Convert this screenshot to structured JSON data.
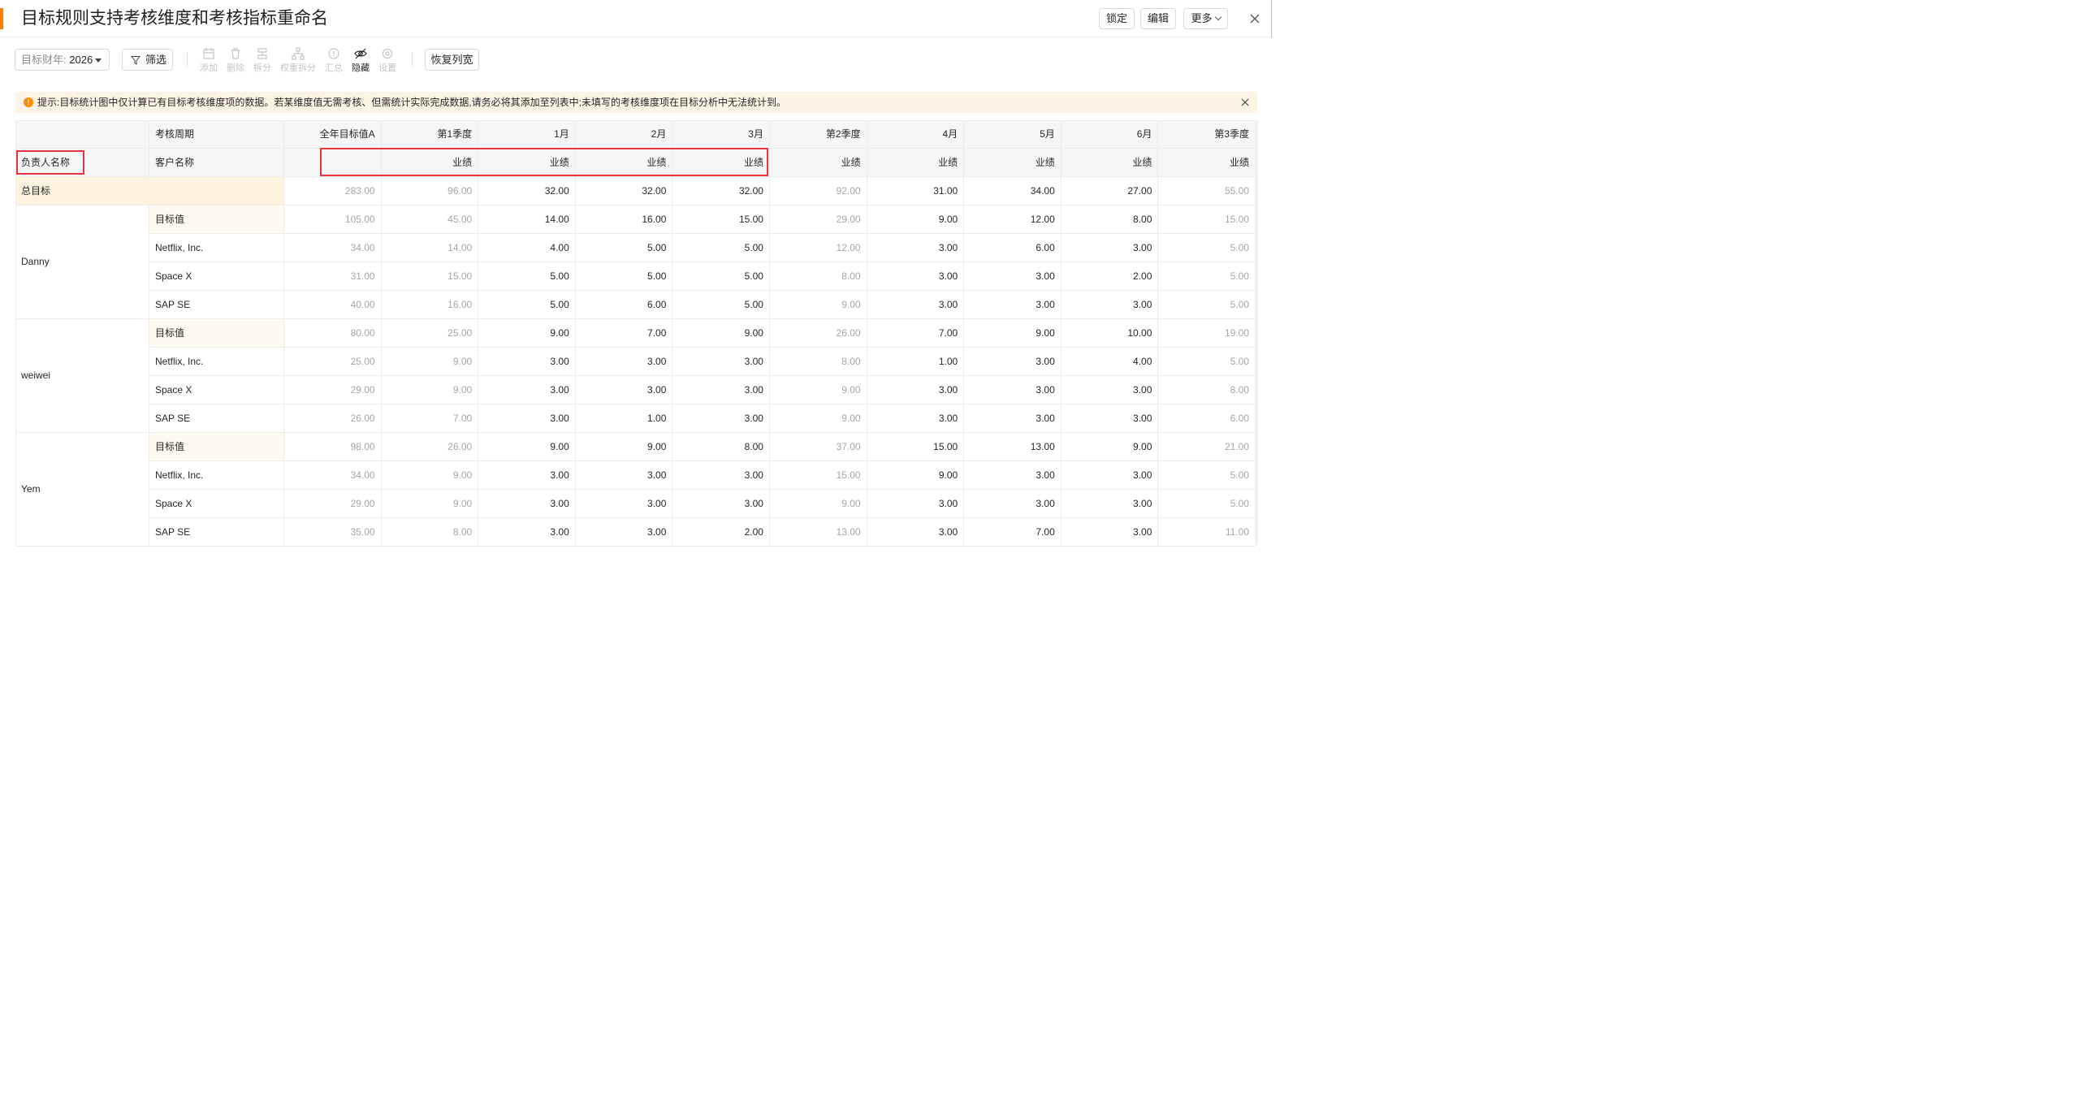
{
  "header": {
    "title": "目标规则支持考核维度和考核指标重命名",
    "lock_label": "锁定",
    "edit_label": "编辑",
    "more_label": "更多"
  },
  "toolbar": {
    "fiscal_year_label": "目标财年:",
    "fiscal_year_value": "2026",
    "filter_label": "筛选",
    "tools": [
      {
        "label": "添加",
        "icon": "add-icon",
        "enabled": false
      },
      {
        "label": "删除",
        "icon": "trash-icon",
        "enabled": false
      },
      {
        "label": "拆分",
        "icon": "split-icon",
        "enabled": false
      },
      {
        "label": "权重拆分",
        "icon": "weight-split-icon",
        "enabled": false
      },
      {
        "label": "汇总",
        "icon": "summary-icon",
        "enabled": false
      },
      {
        "label": "隐藏",
        "icon": "eye-off-icon",
        "enabled": true
      },
      {
        "label": "设置",
        "icon": "settings-icon",
        "enabled": false
      }
    ],
    "reset_width_label": "恢复列宽"
  },
  "notice": {
    "text": "提示:目标统计图中仅计算已有目标考核维度项的数据。若某维度值无需考核、但需统计实际完成数据,请务必将其添加至列表中;未填写的考核维度项在目标分析中无法统计到。"
  },
  "table": {
    "period_header": "考核周期",
    "owner_header": "负责人名称",
    "customer_header": "客户名称",
    "columns": [
      {
        "label": "全年目标值A",
        "metric": "",
        "rollup": true
      },
      {
        "label": "第1季度",
        "metric": "业绩",
        "rollup": true
      },
      {
        "label": "1月",
        "metric": "业绩",
        "rollup": false
      },
      {
        "label": "2月",
        "metric": "业绩",
        "rollup": false
      },
      {
        "label": "3月",
        "metric": "业绩",
        "rollup": false
      },
      {
        "label": "第2季度",
        "metric": "业绩",
        "rollup": true
      },
      {
        "label": "4月",
        "metric": "业绩",
        "rollup": false
      },
      {
        "label": "5月",
        "metric": "业绩",
        "rollup": false
      },
      {
        "label": "6月",
        "metric": "业绩",
        "rollup": false
      },
      {
        "label": "第3季度",
        "metric": "业绩",
        "rollup": true
      }
    ],
    "total": {
      "label": "总目标",
      "values": [
        "283.00",
        "96.00",
        "32.00",
        "32.00",
        "32.00",
        "92.00",
        "31.00",
        "34.00",
        "27.00",
        "55.00"
      ]
    },
    "groups": [
      {
        "owner": "Danny",
        "rows": [
          {
            "name": "目标值",
            "is_target": true,
            "values": [
              "105.00",
              "45.00",
              "14.00",
              "16.00",
              "15.00",
              "29.00",
              "9.00",
              "12.00",
              "8.00",
              "15.00"
            ]
          },
          {
            "name": "Netflix, Inc.",
            "is_target": false,
            "values": [
              "34.00",
              "14.00",
              "4.00",
              "5.00",
              "5.00",
              "12.00",
              "3.00",
              "6.00",
              "3.00",
              "5.00"
            ]
          },
          {
            "name": "Space X",
            "is_target": false,
            "values": [
              "31.00",
              "15.00",
              "5.00",
              "5.00",
              "5.00",
              "8.00",
              "3.00",
              "3.00",
              "2.00",
              "5.00"
            ]
          },
          {
            "name": "SAP SE",
            "is_target": false,
            "values": [
              "40.00",
              "16.00",
              "5.00",
              "6.00",
              "5.00",
              "9.00",
              "3.00",
              "3.00",
              "3.00",
              "5.00"
            ]
          }
        ]
      },
      {
        "owner": "weiwei",
        "rows": [
          {
            "name": "目标值",
            "is_target": true,
            "values": [
              "80.00",
              "25.00",
              "9.00",
              "7.00",
              "9.00",
              "26.00",
              "7.00",
              "9.00",
              "10.00",
              "19.00"
            ]
          },
          {
            "name": "Netflix, Inc.",
            "is_target": false,
            "values": [
              "25.00",
              "9.00",
              "3.00",
              "3.00",
              "3.00",
              "8.00",
              "1.00",
              "3.00",
              "4.00",
              "5.00"
            ]
          },
          {
            "name": "Space X",
            "is_target": false,
            "values": [
              "29.00",
              "9.00",
              "3.00",
              "3.00",
              "3.00",
              "9.00",
              "3.00",
              "3.00",
              "3.00",
              "8.00"
            ]
          },
          {
            "name": "SAP SE",
            "is_target": false,
            "values": [
              "26.00",
              "7.00",
              "3.00",
              "1.00",
              "3.00",
              "9.00",
              "3.00",
              "3.00",
              "3.00",
              "6.00"
            ]
          }
        ]
      },
      {
        "owner": "Yem",
        "rows": [
          {
            "name": "目标值",
            "is_target": true,
            "values": [
              "98.00",
              "26.00",
              "9.00",
              "9.00",
              "8.00",
              "37.00",
              "15.00",
              "13.00",
              "9.00",
              "21.00"
            ]
          },
          {
            "name": "Netflix, Inc.",
            "is_target": false,
            "values": [
              "34.00",
              "9.00",
              "3.00",
              "3.00",
              "3.00",
              "15.00",
              "9.00",
              "3.00",
              "3.00",
              "5.00"
            ]
          },
          {
            "name": "Space X",
            "is_target": false,
            "values": [
              "29.00",
              "9.00",
              "3.00",
              "3.00",
              "3.00",
              "9.00",
              "3.00",
              "3.00",
              "3.00",
              "5.00"
            ]
          },
          {
            "name": "SAP SE",
            "is_target": false,
            "values": [
              "35.00",
              "8.00",
              "3.00",
              "3.00",
              "2.00",
              "13.00",
              "3.00",
              "7.00",
              "3.00",
              "11.00"
            ]
          }
        ]
      }
    ]
  },
  "colors": {
    "accent": "#ff7d00",
    "highlight_box": "#e8343c",
    "total_row_bg": "#fdf3de",
    "notice_bg": "#fdf3e4",
    "muted_text": "#a6a6a6"
  }
}
